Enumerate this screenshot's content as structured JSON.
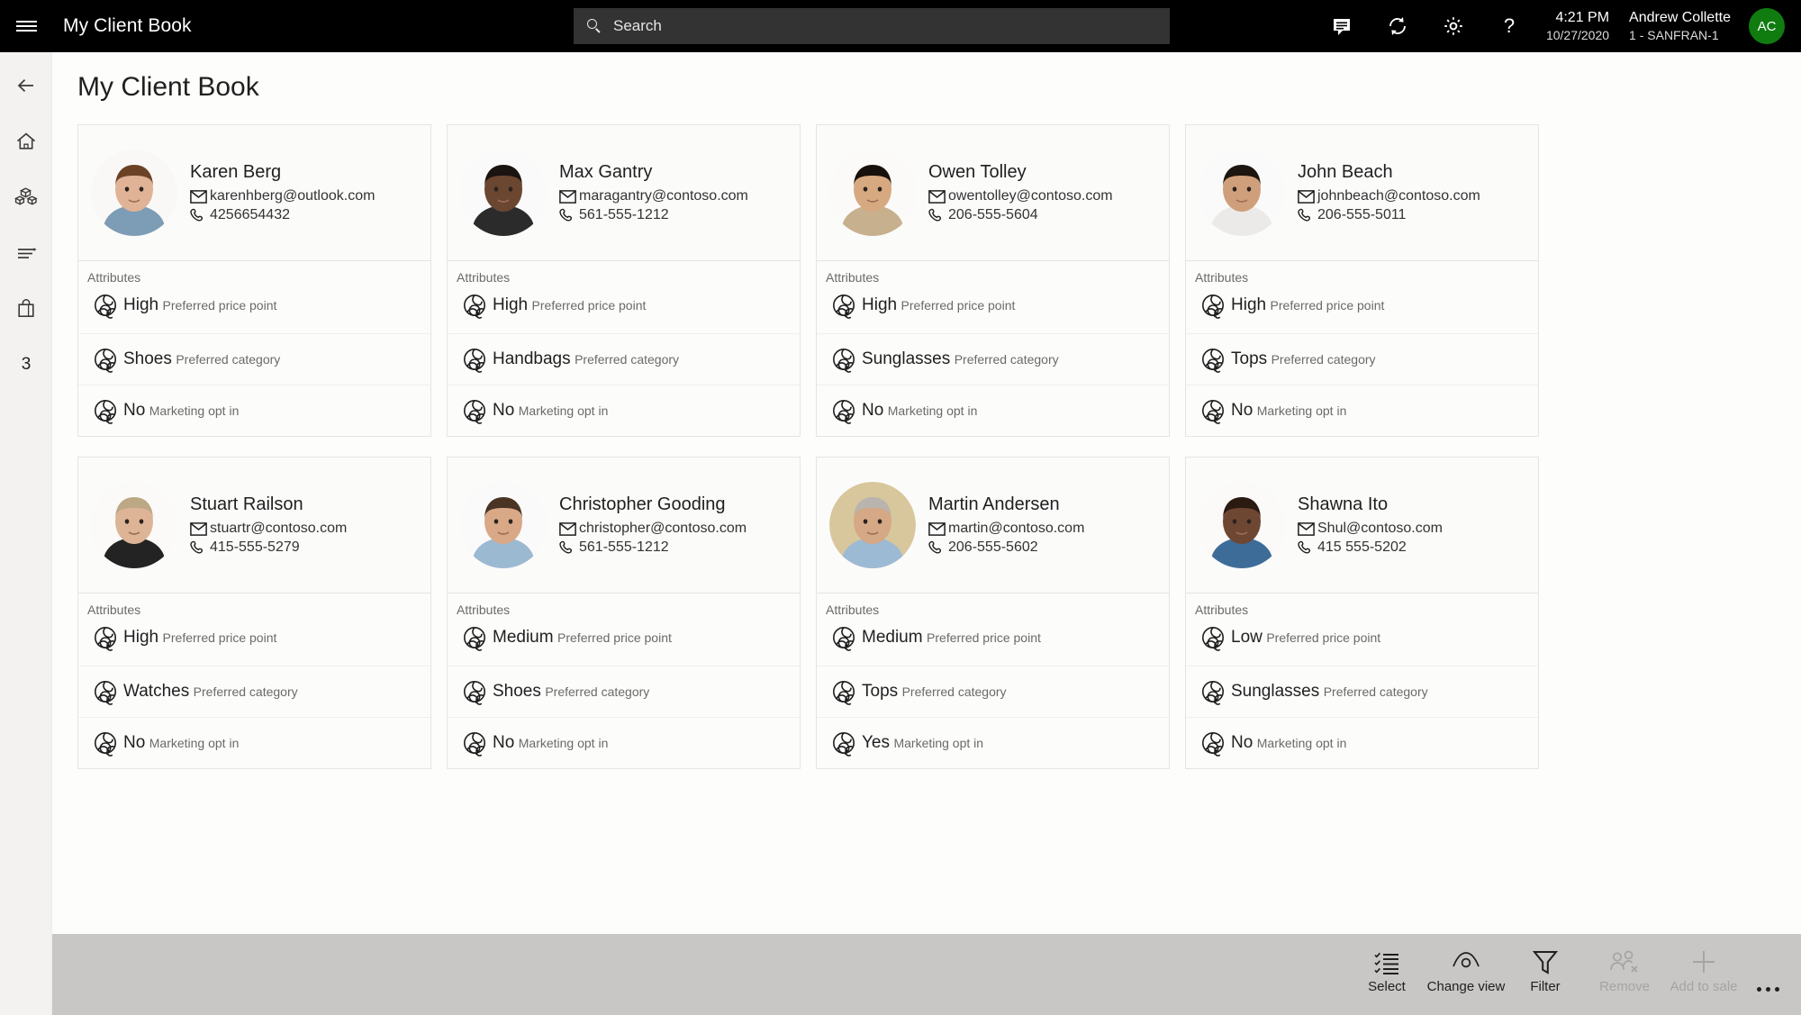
{
  "header": {
    "menu_icon": "hamburger-icon",
    "app_title": "My Client Book",
    "search": {
      "placeholder": "Search",
      "value": "",
      "icon": "search-icon"
    },
    "icons": [
      {
        "name": "notes-icon",
        "label": "Notes"
      },
      {
        "name": "refresh-icon",
        "label": "Refresh"
      },
      {
        "name": "gear-icon",
        "label": "Settings"
      },
      {
        "name": "help-icon",
        "label": "Help"
      }
    ],
    "time": "4:21 PM",
    "date": "10/27/2020",
    "user_name": "Andrew Collette",
    "user_store": "1 - SANFRAN-1",
    "avatar_initials": "AC",
    "avatar_color": "#107c10"
  },
  "left_rail": {
    "items": [
      {
        "name": "back-icon",
        "label": "Back"
      },
      {
        "name": "home-icon",
        "label": "Home"
      },
      {
        "name": "products-icon",
        "label": "Products"
      },
      {
        "name": "list-icon",
        "label": "Transactions"
      },
      {
        "name": "bag-icon",
        "label": "Cart"
      }
    ],
    "count_badge": "3"
  },
  "main": {
    "page_title": "My Client Book",
    "attributes_label": "Attributes",
    "cards": [
      {
        "name": "Karen Berg",
        "email": "karenhberg@outlook.com",
        "phone": "4256654432",
        "photo": "woman-brown-hair",
        "attributes": [
          {
            "value": "High",
            "label": "Preferred price point"
          },
          {
            "value": "Shoes",
            "label": "Preferred category"
          },
          {
            "value": "No",
            "label": "Marketing opt in"
          }
        ]
      },
      {
        "name": "Max Gantry",
        "email": "maragantry@contoso.com",
        "phone": "561-555-1212",
        "photo": "man-dark-skin",
        "attributes": [
          {
            "value": "High",
            "label": "Preferred price point"
          },
          {
            "value": "Handbags",
            "label": "Preferred category"
          },
          {
            "value": "No",
            "label": "Marketing opt in"
          }
        ]
      },
      {
        "name": "Owen Tolley",
        "email": "owentolley@contoso.com",
        "phone": "206-555-5604",
        "photo": "man-asian-tan-shirt",
        "attributes": [
          {
            "value": "High",
            "label": "Preferred price point"
          },
          {
            "value": "Sunglasses",
            "label": "Preferred category"
          },
          {
            "value": "No",
            "label": "Marketing opt in"
          }
        ]
      },
      {
        "name": "John Beach",
        "email": "johnbeach@contoso.com",
        "phone": "206-555-5011",
        "photo": "man-dark-hair-white-shirt",
        "attributes": [
          {
            "value": "High",
            "label": "Preferred price point"
          },
          {
            "value": "Tops",
            "label": "Preferred category"
          },
          {
            "value": "No",
            "label": "Marketing opt in"
          }
        ]
      },
      {
        "name": "Stuart Railson",
        "email": "stuartr@contoso.com",
        "phone": "415-555-5279",
        "photo": "older-man-blond-beard",
        "attributes": [
          {
            "value": "High",
            "label": "Preferred price point"
          },
          {
            "value": "Watches",
            "label": "Preferred category"
          },
          {
            "value": "No",
            "label": "Marketing opt in"
          }
        ]
      },
      {
        "name": "Christopher Gooding",
        "email": "christopher@contoso.com",
        "phone": "561-555-1212",
        "photo": "man-blue-shirt-suit",
        "attributes": [
          {
            "value": "Medium",
            "label": "Preferred price point"
          },
          {
            "value": "Shoes",
            "label": "Preferred category"
          },
          {
            "value": "No",
            "label": "Marketing opt in"
          }
        ]
      },
      {
        "name": "Martin Andersen",
        "email": "martin@contoso.com",
        "phone": "206-555-5602",
        "photo": "older-man-grey-hair-store",
        "attributes": [
          {
            "value": "Medium",
            "label": "Preferred price point"
          },
          {
            "value": "Tops",
            "label": "Preferred category"
          },
          {
            "value": "Yes",
            "label": "Marketing opt in"
          }
        ]
      },
      {
        "name": "Shawna Ito",
        "email": "Shul@contoso.com",
        "phone": "415 555-5202",
        "photo": "woman-dark-skin-curly",
        "attributes": [
          {
            "value": "Low",
            "label": "Preferred price point"
          },
          {
            "value": "Sunglasses",
            "label": "Preferred category"
          },
          {
            "value": "No",
            "label": "Marketing opt in"
          }
        ]
      }
    ]
  },
  "command_bar": {
    "buttons": [
      {
        "label": "Select",
        "icon": "select-list-icon",
        "disabled": false
      },
      {
        "label": "Change view",
        "icon": "eye-icon",
        "disabled": false
      },
      {
        "label": "Filter",
        "icon": "funnel-icon",
        "disabled": false
      },
      {
        "label": "Remove",
        "icon": "remove-person-icon",
        "disabled": true
      },
      {
        "label": "Add to sale",
        "icon": "plus-icon",
        "disabled": true
      }
    ],
    "overflow": "overflow-dots-icon"
  }
}
